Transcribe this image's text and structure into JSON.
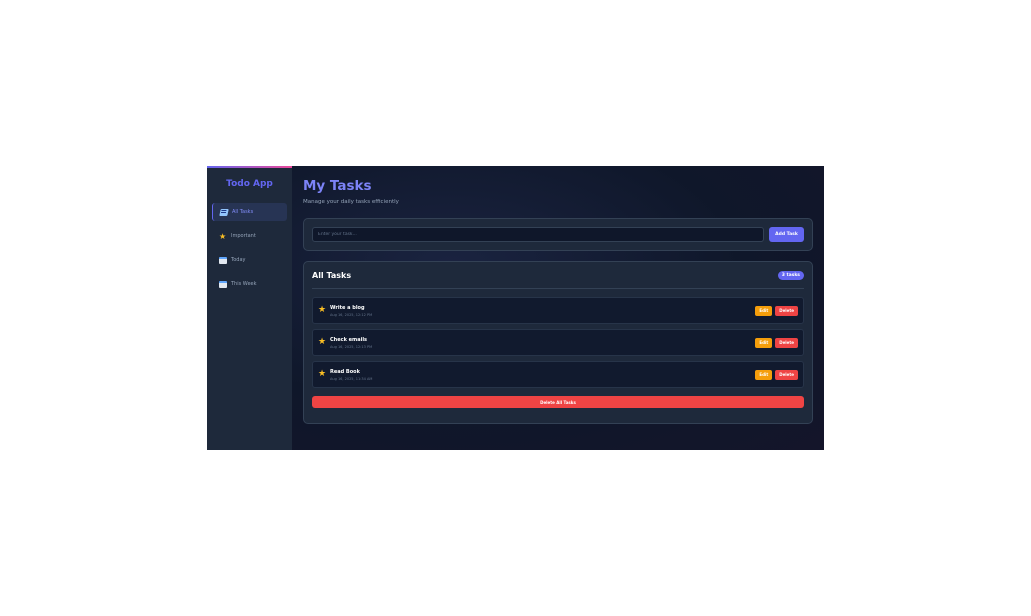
{
  "sidebar": {
    "brand": "Todo App",
    "items": [
      {
        "label": "All Tasks",
        "icon": "notebook-icon",
        "active": true
      },
      {
        "label": "Important",
        "icon": "star-icon",
        "active": false
      },
      {
        "label": "Today",
        "icon": "calendar-icon",
        "active": false
      },
      {
        "label": "This Week",
        "icon": "calendar-icon",
        "active": false
      }
    ]
  },
  "header": {
    "title": "My Tasks",
    "subtitle": "Manage your daily tasks efficiently"
  },
  "input": {
    "placeholder": "Enter your task...",
    "add_label": "Add Task"
  },
  "tasks": {
    "title": "All Tasks",
    "count_badge": "3 tasks",
    "items": [
      {
        "name": "Write a blog",
        "date": "Aug 16, 2025, 12:12 PM",
        "edit_label": "Edit",
        "delete_label": "Delete"
      },
      {
        "name": "Check emails",
        "date": "Aug 16, 2025, 12:13 PM",
        "edit_label": "Edit",
        "delete_label": "Delete"
      },
      {
        "name": "Read Book",
        "date": "Aug 16, 2025, 11:34 AM",
        "edit_label": "Edit",
        "delete_label": "Delete"
      }
    ],
    "delete_all_label": "Delete All Tasks"
  },
  "colors": {
    "accent": "#6366f1",
    "danger": "#ef4444",
    "warning": "#f59e0b",
    "star": "#fbbf24",
    "background": "#0f172a",
    "sidebar": "#1e293b"
  }
}
